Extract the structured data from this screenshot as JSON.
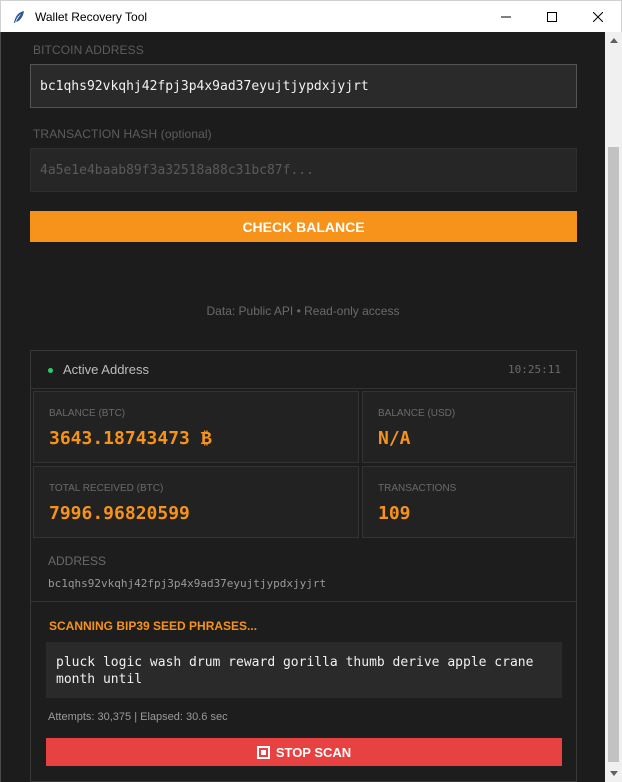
{
  "window": {
    "title": "Wallet Recovery Tool"
  },
  "form": {
    "address_label": "BITCOIN ADDRESS",
    "address_value": "bc1qhs92vkqhj42fpj3p4x9ad37eyujtjypdxjyjrt",
    "hash_label": "TRANSACTION HASH",
    "hash_label_opt": "(optional)",
    "hash_placeholder": "4a5e1e4baab89f3a32518a88c31bc87f...",
    "check_button": "CHECK BALANCE"
  },
  "info_text": "Data: Public API  •  Read-only access",
  "card": {
    "title": "Active Address",
    "time": "10:25:11",
    "balance_btc_label": "BALANCE (BTC)",
    "balance_btc_value": "3643.18743473 ₿",
    "balance_usd_label": "BALANCE (USD)",
    "balance_usd_value": "N/A",
    "total_received_label": "TOTAL RECEIVED (BTC)",
    "total_received_value": "7996.96820599",
    "transactions_label": "TRANSACTIONS",
    "transactions_value": "109",
    "address_label": "ADDRESS",
    "address_value": "bc1qhs92vkqhj42fpj3p4x9ad37eyujtjypdxjyjrt"
  },
  "scan": {
    "label": "SCANNING BIP39 SEED PHRASES...",
    "seed_phrase": "pluck logic wash drum reward gorilla thumb derive apple crane month until",
    "stats": "Attempts: 30,375 | Elapsed: 30.6 sec",
    "stop_button": "STOP SCAN"
  },
  "colors": {
    "accent": "#f7931a",
    "danger": "#e84141",
    "status": "#2ecc71",
    "background": "#1c1c1c"
  },
  "icons": {
    "app": "feather-icon",
    "stop": "stop-icon"
  }
}
